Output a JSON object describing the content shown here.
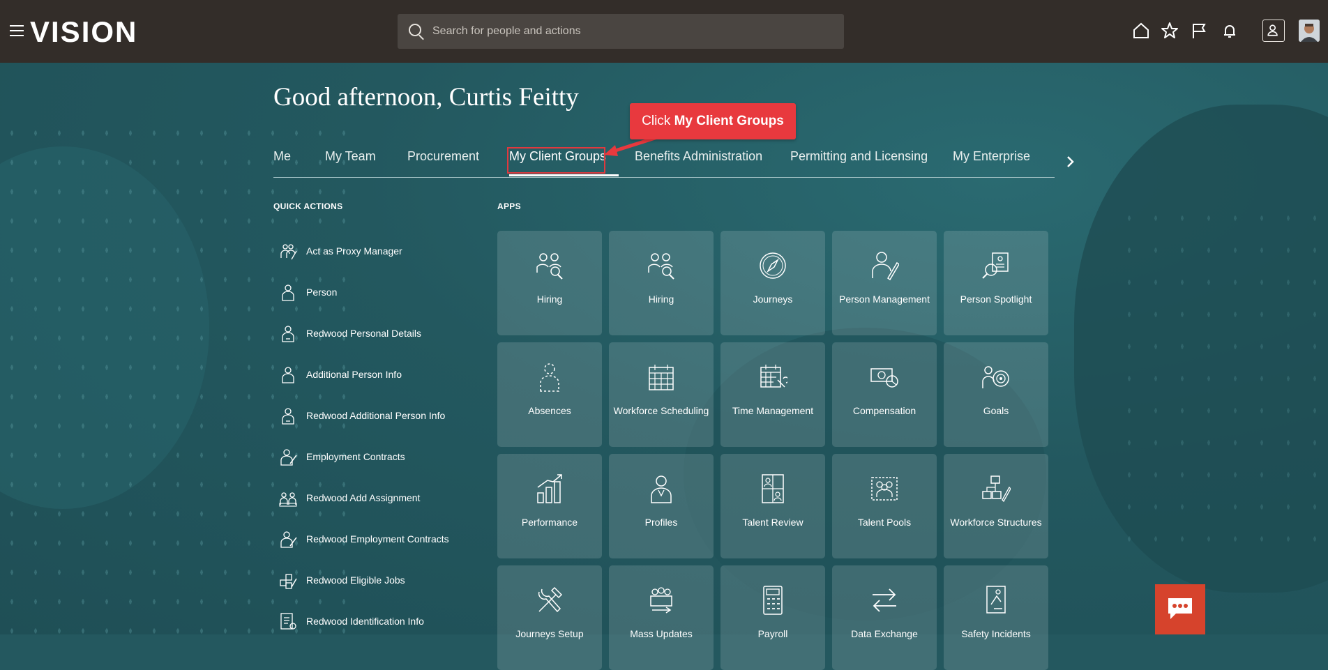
{
  "header": {
    "logo": "VISION",
    "search_placeholder": "Search for people and actions",
    "icons": [
      "menu-icon",
      "home-icon",
      "star-icon",
      "flag-icon",
      "bell-icon",
      "user-icon",
      "avatar"
    ]
  },
  "greeting": "Good afternoon, Curtis Feitty",
  "tabs": [
    {
      "label": "Me"
    },
    {
      "label": "My Team"
    },
    {
      "label": "Procurement"
    },
    {
      "label": "My Client Groups"
    },
    {
      "label": "Benefits Administration"
    },
    {
      "label": "Permitting and Licensing"
    },
    {
      "label": "My Enterprise"
    }
  ],
  "callout": {
    "prefix": "Click ",
    "bold": "My Client Groups"
  },
  "quick_actions": {
    "title": "QUICK ACTIONS",
    "items": [
      {
        "label": "Act as Proxy Manager"
      },
      {
        "label": "Person"
      },
      {
        "label": "Redwood Personal Details"
      },
      {
        "label": "Additional Person Info"
      },
      {
        "label": "Redwood Additional Person Info"
      },
      {
        "label": "Employment Contracts"
      },
      {
        "label": "Redwood Add Assignment"
      },
      {
        "label": "Redwood Employment Contracts"
      },
      {
        "label": "Redwood Eligible Jobs"
      },
      {
        "label": "Redwood Identification Info"
      }
    ]
  },
  "apps": {
    "title": "APPS",
    "tiles": [
      {
        "label": "Hiring",
        "icon": "hiring-icon"
      },
      {
        "label": "Hiring",
        "icon": "hiring-icon"
      },
      {
        "label": "Journeys",
        "icon": "compass-icon"
      },
      {
        "label": "Person Management",
        "icon": "person-edit-icon"
      },
      {
        "label": "Person Spotlight",
        "icon": "spotlight-icon"
      },
      {
        "label": "Absences",
        "icon": "absence-icon"
      },
      {
        "label": "Workforce Scheduling",
        "icon": "calendar-icon"
      },
      {
        "label": "Time Management",
        "icon": "time-calendar-icon"
      },
      {
        "label": "Compensation",
        "icon": "money-icon"
      },
      {
        "label": "Goals",
        "icon": "target-icon"
      },
      {
        "label": "Performance",
        "icon": "chart-up-icon"
      },
      {
        "label": "Profiles",
        "icon": "profile-icon"
      },
      {
        "label": "Talent Review",
        "icon": "talent-review-icon"
      },
      {
        "label": "Talent Pools",
        "icon": "talent-pool-icon"
      },
      {
        "label": "Workforce Structures",
        "icon": "structure-icon"
      },
      {
        "label": "Journeys Setup",
        "icon": "tools-icon"
      },
      {
        "label": "Mass Updates",
        "icon": "mass-update-icon"
      },
      {
        "label": "Payroll",
        "icon": "calculator-icon"
      },
      {
        "label": "Data Exchange",
        "icon": "exchange-icon"
      },
      {
        "label": "Safety Incidents",
        "icon": "safety-icon"
      }
    ]
  }
}
